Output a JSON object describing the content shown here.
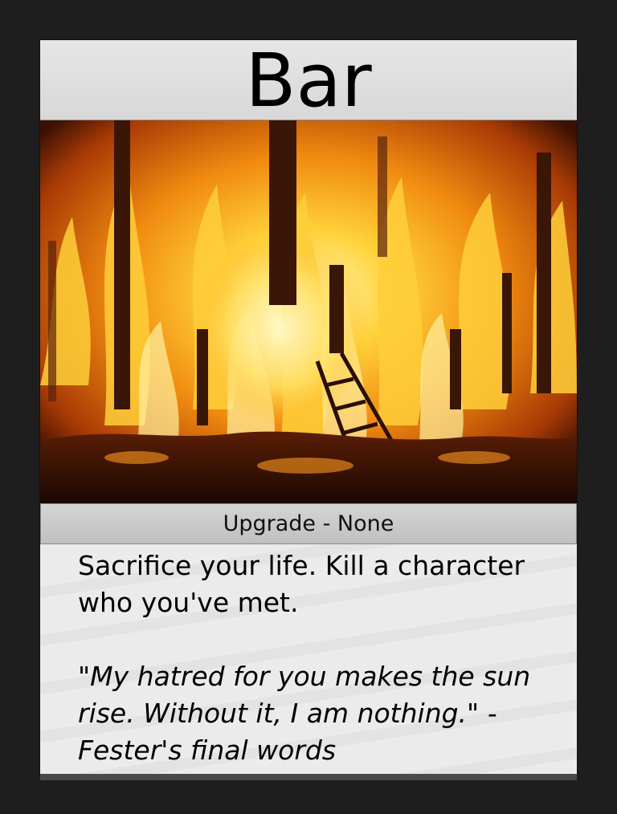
{
  "card": {
    "title": "Bar",
    "type_line": "Upgrade - None",
    "rules_text": "Sacrifice your life. Kill a character who you've met.",
    "flavor_text": "\"My hatred for you makes the sun rise. Without it, I am nothing.\" -Fester's final words",
    "art_subject": "burning-building-fire"
  },
  "colors": {
    "frame": "#1e1e1e",
    "title_bar": "#e0e0e0",
    "type_bar": "#c8c8c8",
    "text_box": "#ebebeb"
  }
}
